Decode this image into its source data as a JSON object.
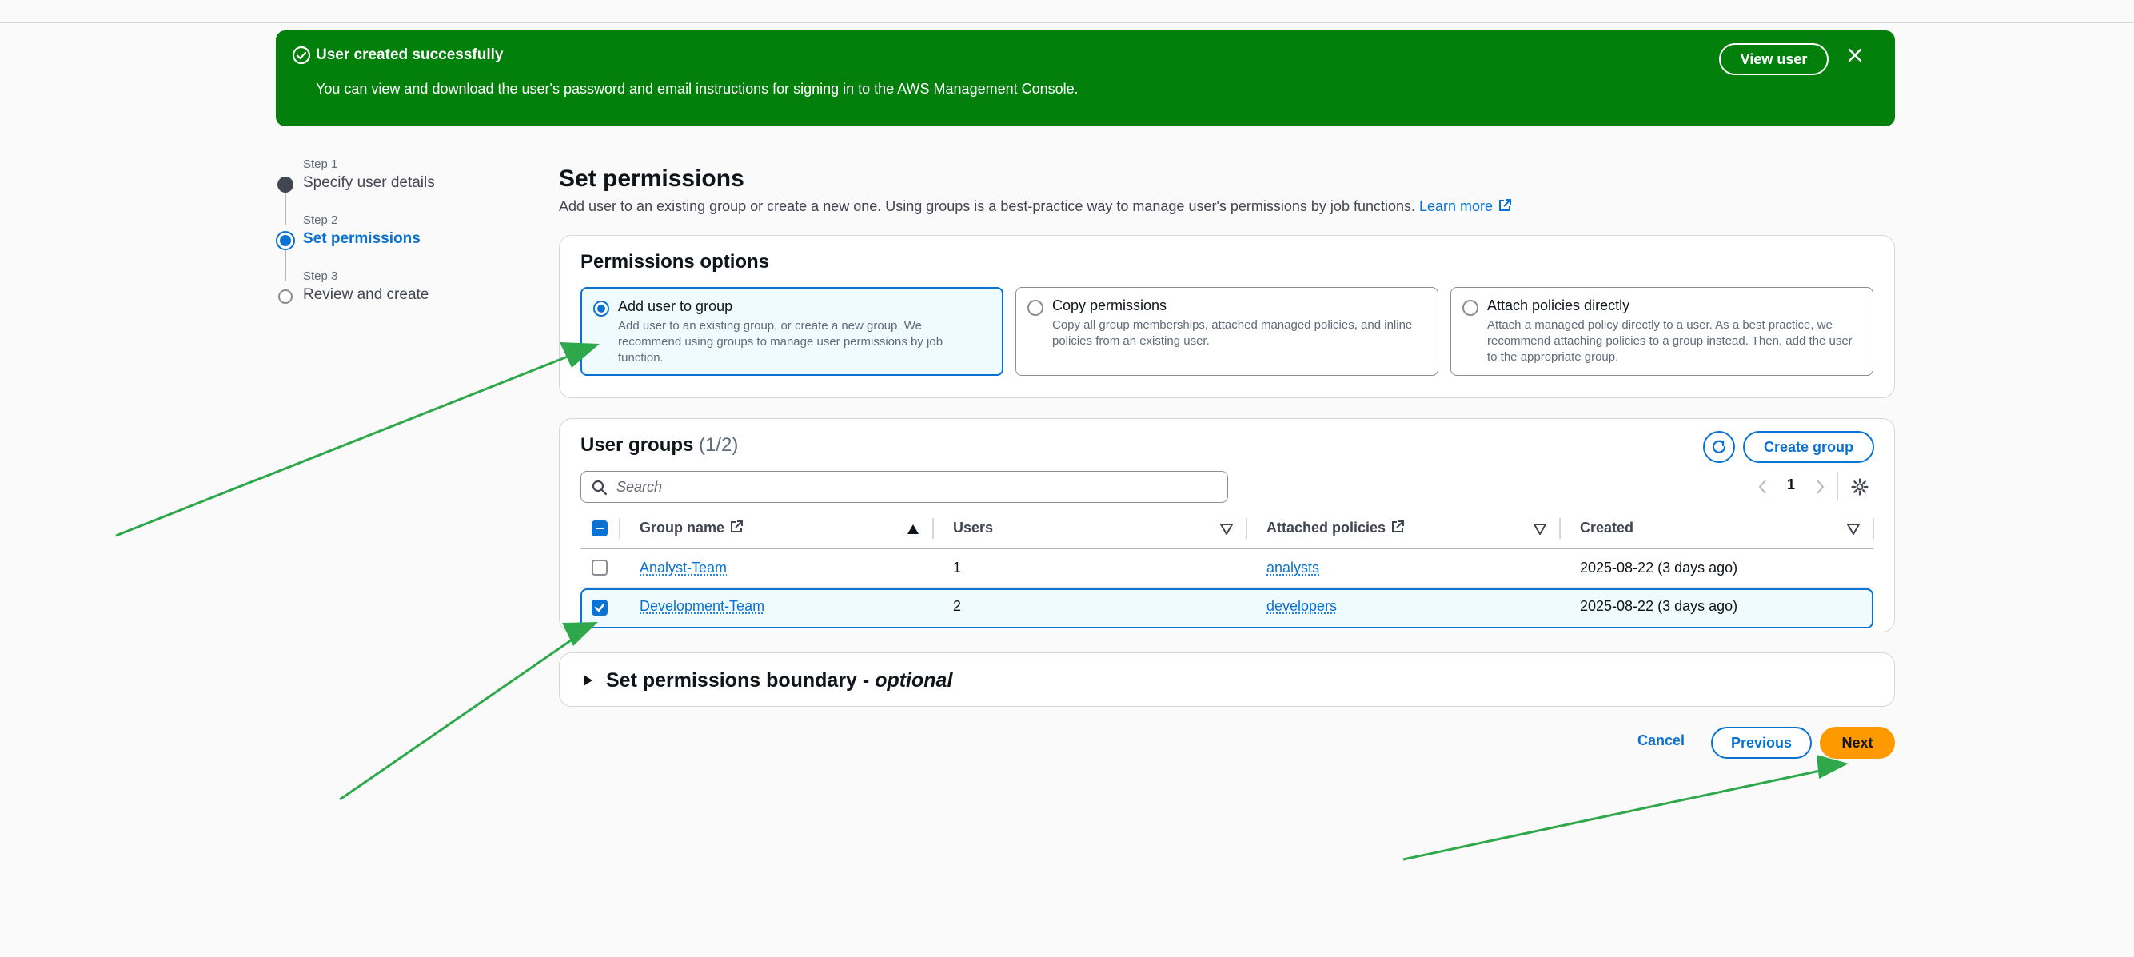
{
  "flash": {
    "title": "User created successfully",
    "message": "You can view and download the user's password and email instructions for signing in to the AWS Management Console.",
    "view_label": "View user",
    "icons": {
      "status": "success-check-icon",
      "close": "close-icon"
    },
    "color": "#037f0c"
  },
  "wizard": {
    "steps": [
      {
        "num": "Step 1",
        "name": "Specify user details",
        "state": "completed"
      },
      {
        "num": "Step 2",
        "name": "Set permissions",
        "state": "active"
      },
      {
        "num": "Step 3",
        "name": "Review and create",
        "state": "pending"
      }
    ]
  },
  "page": {
    "title": "Set permissions",
    "description": "Add user to an existing group or create a new one. Using groups is a best-practice way to manage user's permissions by job functions.",
    "learn_more": "Learn more"
  },
  "options": {
    "title": "Permissions options",
    "items": [
      {
        "label": "Add user to group",
        "desc": "Add user to an existing group, or create a new group. We recommend using groups to manage user permissions by job function.",
        "selected": true
      },
      {
        "label": "Copy permissions",
        "desc": "Copy all group memberships, attached managed policies, and inline policies from an existing user.",
        "selected": false
      },
      {
        "label": "Attach policies directly",
        "desc": "Attach a managed policy directly to a user. As a best practice, we recommend attaching policies to a group instead. Then, add the user to the appropriate group.",
        "selected": false
      }
    ]
  },
  "groups": {
    "title": "User groups",
    "count": "(1/2)",
    "create_label": "Create group",
    "search_placeholder": "Search",
    "page": "1",
    "columns": [
      "Group name",
      "Users",
      "Attached policies",
      "Created"
    ],
    "rows": [
      {
        "name": "Analyst-Team",
        "users": "1",
        "policies": "analysts",
        "created": "2025-08-22 (3 days ago)",
        "checked": false
      },
      {
        "name": "Development-Team",
        "users": "2",
        "policies": "developers",
        "created": "2025-08-22 (3 days ago)",
        "checked": true
      }
    ]
  },
  "boundary": {
    "title": "Set permissions boundary - ",
    "optional": "optional"
  },
  "actions": {
    "cancel": "Cancel",
    "previous": "Previous",
    "next": "Next"
  },
  "colors": {
    "accent": "#0972d3",
    "primary_button": "#ff9900",
    "annotation_arrow": "#2ea84a"
  }
}
